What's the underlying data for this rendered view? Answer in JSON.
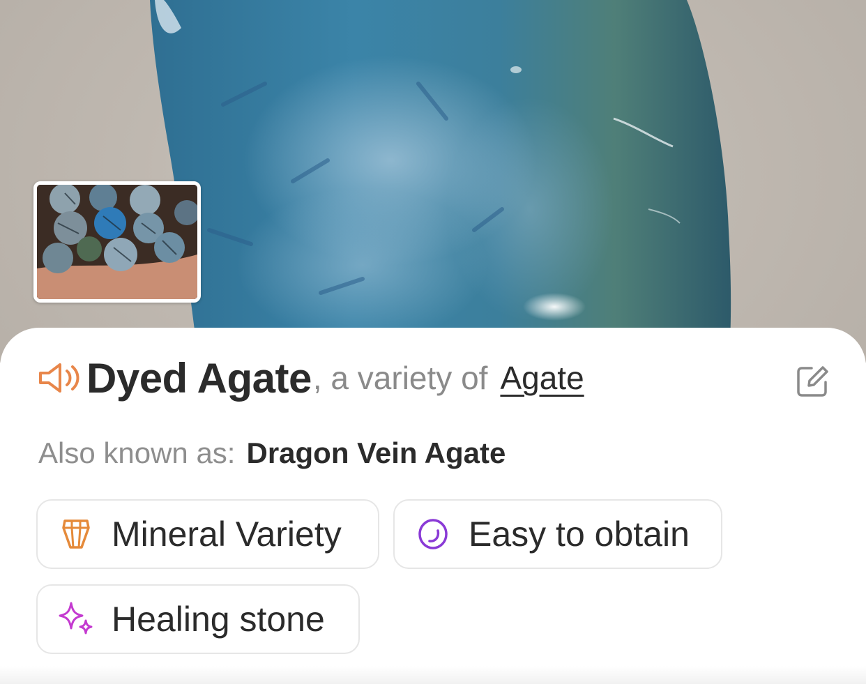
{
  "hero": {
    "photo_icon": "polished-blue-agate-stone-photo",
    "thumbnail_icon": "agate-beads-photo"
  },
  "species": {
    "name": "Dyed Agate",
    "variety_of_text": ", a variety of",
    "parent_name": "Agate"
  },
  "icons": {
    "speaker": "speaker-icon",
    "edit": "edit-icon"
  },
  "aka": {
    "label": "Also known as:",
    "value": "Dragon Vein Agate"
  },
  "chips": [
    {
      "label": "Mineral Variety",
      "icon": "crystal-icon",
      "color": "#e58a3a"
    },
    {
      "label": "Easy to obtain",
      "icon": "gem-ring-icon",
      "color": "#8a3ad6"
    },
    {
      "label": "Healing stone",
      "icon": "sparkle-icon",
      "color": "#c43ad0"
    }
  ],
  "colors": {
    "speaker": "#e8864a",
    "title": "#2b2b2b",
    "muted": "#8a8a8a",
    "chip_border": "#e6e6e6"
  }
}
